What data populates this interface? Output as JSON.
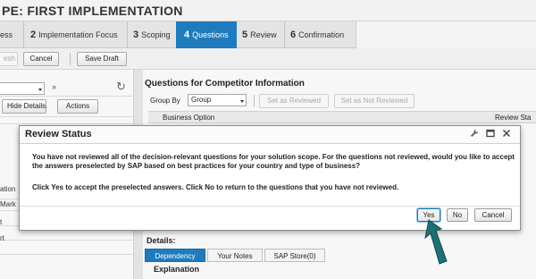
{
  "header": {
    "title": "PE: FIRST IMPLEMENTATION"
  },
  "roadmap": {
    "steps": [
      {
        "num": "",
        "label": "ess"
      },
      {
        "num": "2",
        "label": "Implementation Focus"
      },
      {
        "num": "3",
        "label": "Scoping"
      },
      {
        "num": "4",
        "label": "Questions"
      },
      {
        "num": "5",
        "label": "Review"
      },
      {
        "num": "6",
        "label": "Confirmation"
      }
    ],
    "active_index": 3
  },
  "toolbar": {
    "refresh_label": "esh",
    "cancel_label": "Cancel",
    "save_draft_label": "Save Draft"
  },
  "left_pane": {
    "nav_label": "»",
    "refresh_icon": "refresh-icon",
    "hide_details_label": "Hide Details",
    "actions_label": "Actions",
    "items": [
      "ation",
      "Mark",
      "t",
      "rt"
    ]
  },
  "right_pane": {
    "section_title": "Questions for Competitor Information",
    "group_by_label": "Group By",
    "group_value": "Group",
    "set_reviewed_label": "Set as Reviewed",
    "set_not_reviewed_label": "Set as Not Reviewed",
    "columns": [
      "Business Option",
      "Review Sta"
    ],
    "details_label": "Details:",
    "tabs": [
      "Dependency",
      "Your Notes",
      "SAP Store(0)"
    ],
    "explanation_label": "Explanation"
  },
  "dialog": {
    "title": "Review Status",
    "icons": [
      "wrench-icon",
      "maximize-icon",
      "close-icon"
    ],
    "message_1": "You have not reviewed all of the decision-relevant questions for your solution scope. For the questions not reviewed, would you like to accept the answers preselected by SAP based on best practices for your country and type of business?",
    "message_2": "Click Yes to accept the preselected answers. Click No to return to the questions that you have not reviewed.",
    "yes_label": "Yes",
    "no_label": "No",
    "cancel_label": "Cancel"
  },
  "colors": {
    "accent": "#1f7bbd",
    "pointer": "#1f6f73"
  }
}
